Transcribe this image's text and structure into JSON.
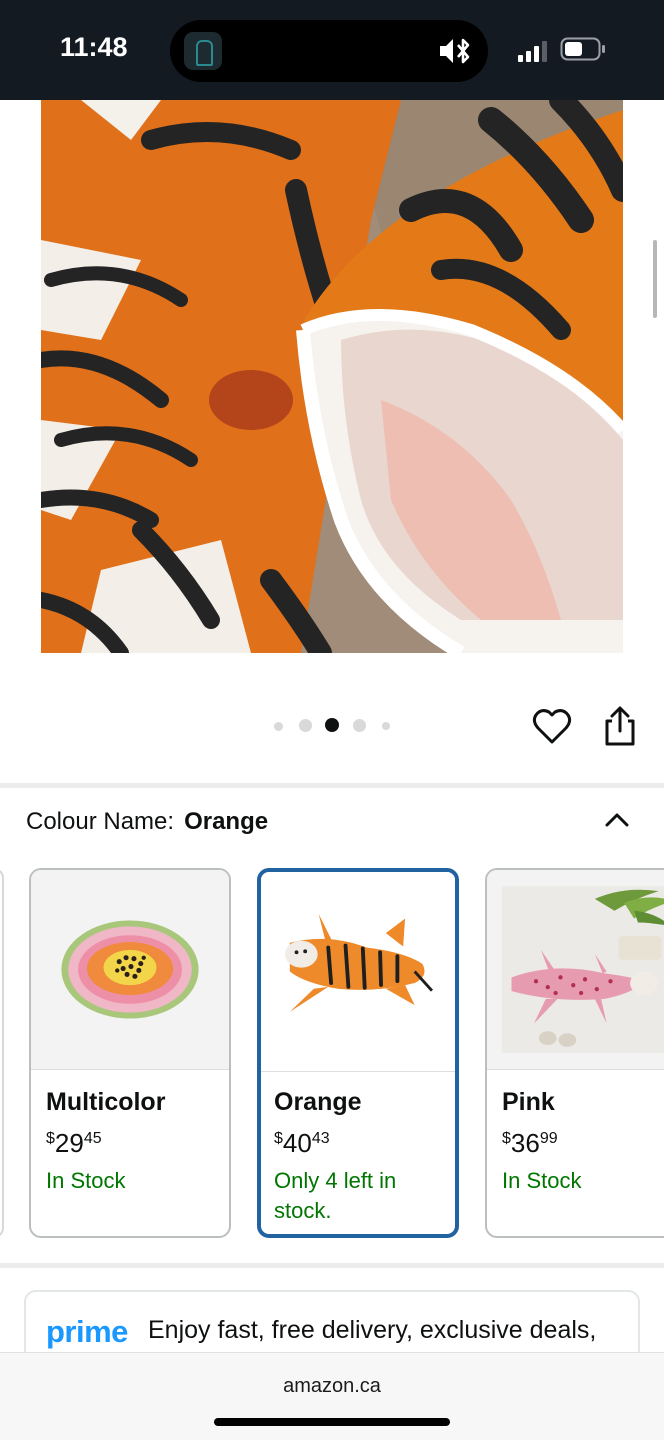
{
  "status_bar": {
    "time": "11:48",
    "icons": [
      "app-activity-icon",
      "silent-mode-icon",
      "signal-icon",
      "battery-icon"
    ]
  },
  "gallery": {
    "image_count": 5,
    "active_index": 2,
    "actions": [
      "heart-icon",
      "share-icon"
    ]
  },
  "colour": {
    "label": "Colour Name:",
    "selected": "Orange"
  },
  "variants": [
    {
      "name": "Multicolor",
      "price_symbol": "$",
      "price_whole": "29",
      "price_fraction": "45",
      "stock": "In Stock"
    },
    {
      "name": "Orange",
      "price_symbol": "$",
      "price_whole": "40",
      "price_fraction": "43",
      "stock": "Only 4 left in stock."
    },
    {
      "name": "Pink",
      "price_symbol": "$",
      "price_whole": "36",
      "price_fraction": "99",
      "stock": "In Stock"
    }
  ],
  "prime": {
    "logo": "prime",
    "text": "Enjoy fast, free delivery, exclusive deals,"
  },
  "browser": {
    "url": "amazon.ca"
  },
  "colors": {
    "status_bar_bg": "#131a22",
    "selected_border": "#2162a1",
    "stock_green": "#007600",
    "prime_blue": "#1a98ff"
  }
}
